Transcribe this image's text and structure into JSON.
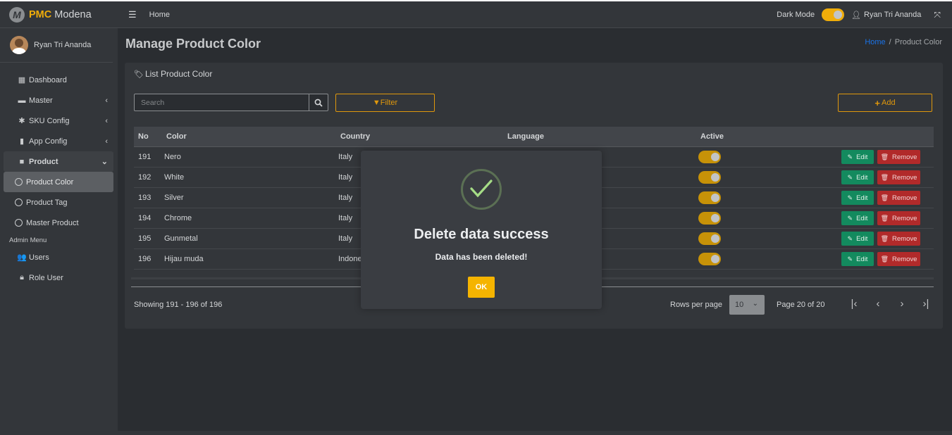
{
  "brand": {
    "logo_letter": "M",
    "name_bold": "PMC",
    "name_rest": " Modena"
  },
  "topbar": {
    "home": "Home",
    "dark_mode_label": "Dark Mode",
    "user_name": "Ryan Tri Ananda",
    "dark_mode_on": true
  },
  "sidebar": {
    "user_name": "Ryan Tri Ananda",
    "items": [
      {
        "label": "Dashboard",
        "icon": "grid-icon"
      },
      {
        "label": "Master",
        "icon": "car-icon"
      },
      {
        "label": "SKU Config",
        "icon": "gear-icon"
      },
      {
        "label": "App Config",
        "icon": "mobile-icon"
      },
      {
        "label": "Product",
        "icon": "briefcase-icon"
      }
    ],
    "sub_items": [
      {
        "label": "Product Color",
        "active": true
      },
      {
        "label": "Product Tag"
      },
      {
        "label": "Master Product"
      }
    ],
    "admin_header": "Admin Menu",
    "admin_items": [
      {
        "label": "Users",
        "icon": "users-icon"
      },
      {
        "label": "Role User",
        "icon": "lock-icon"
      }
    ]
  },
  "page": {
    "title": "Manage Product Color",
    "breadcrumb_home": "Home",
    "breadcrumb_sep": "/",
    "breadcrumb_current": "Product Color"
  },
  "card": {
    "title": "List Product Color",
    "search_placeholder": "Search",
    "filter_label": "Filter",
    "add_label": "Add",
    "columns": [
      "No",
      "Color",
      "Country",
      "Language",
      "Active"
    ],
    "edit_label": "Edit",
    "remove_label": "Remove",
    "rows": [
      {
        "no": "191",
        "color": "Nero",
        "country": "Italy",
        "language": "",
        "active": true
      },
      {
        "no": "192",
        "color": "White",
        "country": "Italy",
        "language": "",
        "active": true
      },
      {
        "no": "193",
        "color": "Silver",
        "country": "Italy",
        "language": "",
        "active": true
      },
      {
        "no": "194",
        "color": "Chrome",
        "country": "Italy",
        "language": "",
        "active": true
      },
      {
        "no": "195",
        "color": "Gunmetal",
        "country": "Italy",
        "language": "",
        "active": true
      },
      {
        "no": "196",
        "color": "Hijau muda",
        "country": "Indone",
        "language": "",
        "active": true
      }
    ],
    "showing": "Showing 191 - 196 of 196",
    "rows_per_page_label": "Rows per page",
    "rows_per_page_value": "10",
    "page_info": "Page 20 of 20"
  },
  "modal": {
    "title": "Delete data success",
    "text": "Data has been deleted!",
    "ok_label": "OK"
  },
  "colors": {
    "accent": "#f0ad0a",
    "edit": "#138a5e",
    "remove": "#b12a2a",
    "ok": "#f5b400"
  }
}
